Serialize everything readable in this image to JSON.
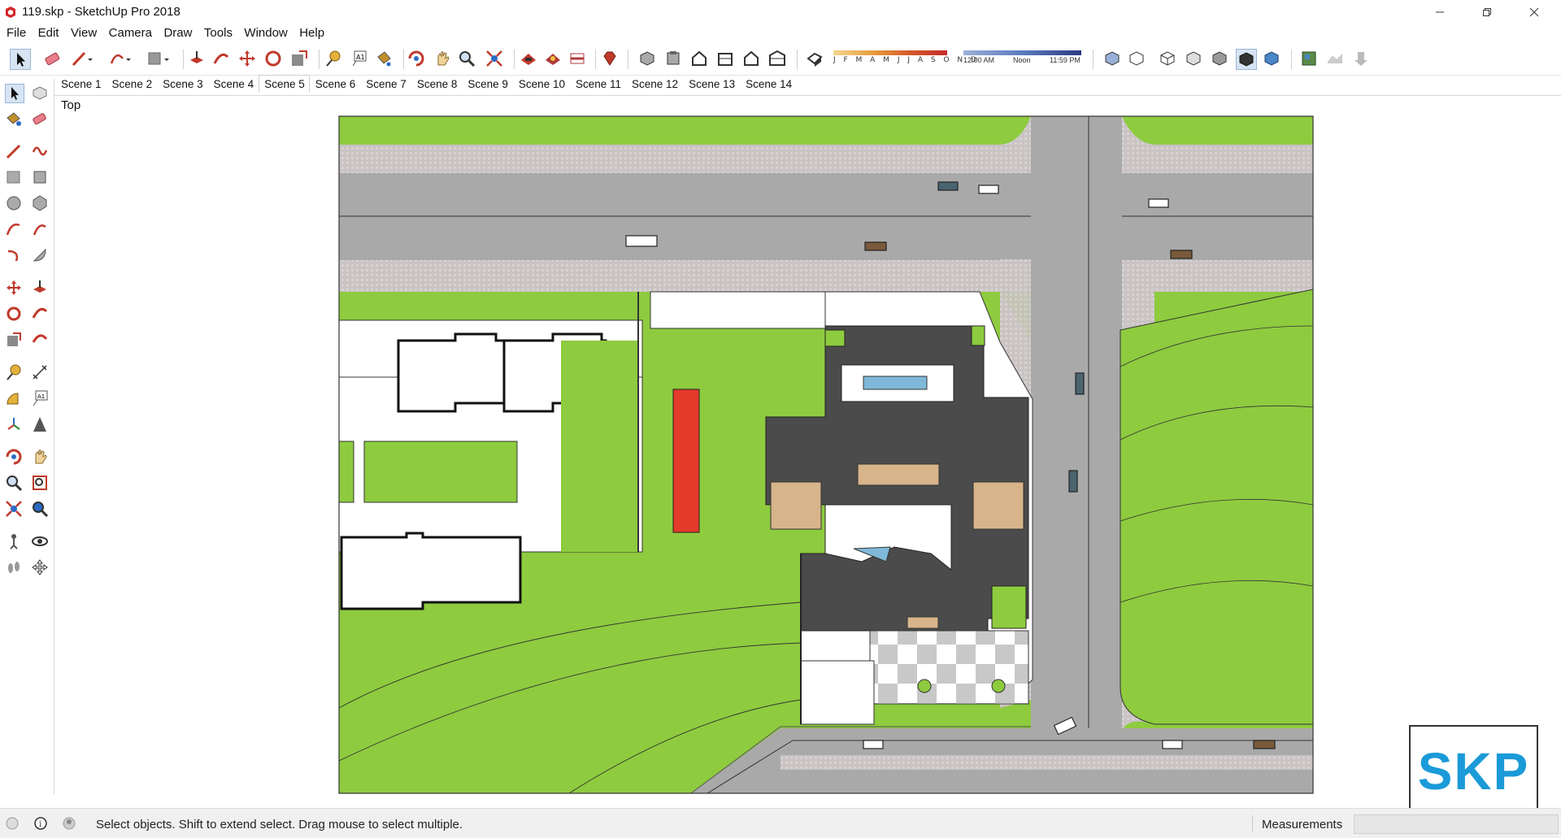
{
  "window": {
    "title": "119.skp - SketchUp Pro 2018"
  },
  "menu": [
    "File",
    "Edit",
    "View",
    "Camera",
    "Draw",
    "Tools",
    "Window",
    "Help"
  ],
  "shadow_bar": {
    "months": "J F M A M J J A S O N D",
    "time_start": "12:00 AM",
    "time_mid": "Noon",
    "time_end": "11:59 PM"
  },
  "scenes": [
    "Scene 1",
    "Scene 2",
    "Scene 3",
    "Scene 4",
    "Scene 5",
    "Scene 6",
    "Scene 7",
    "Scene 8",
    "Scene 9",
    "Scene 10",
    "Scene 11",
    "Scene 12",
    "Scene 13",
    "Scene 14"
  ],
  "active_scene": "Scene 5",
  "viewport": {
    "view_label": "Top"
  },
  "status": {
    "hint": "Select objects. Shift to extend select. Drag mouse to select multiple.",
    "measurements_label": "Measurements",
    "measurements_value": ""
  },
  "logo": {
    "text": "SKP"
  },
  "colors": {
    "grass": "#8ecb3f",
    "road": "#a9a9a9",
    "building": "#4b4b4b",
    "accent": "#1a9ad8",
    "pool": "#7fb8d8",
    "red_stripe": "#e43a2c",
    "wood": "#d7b48a"
  }
}
